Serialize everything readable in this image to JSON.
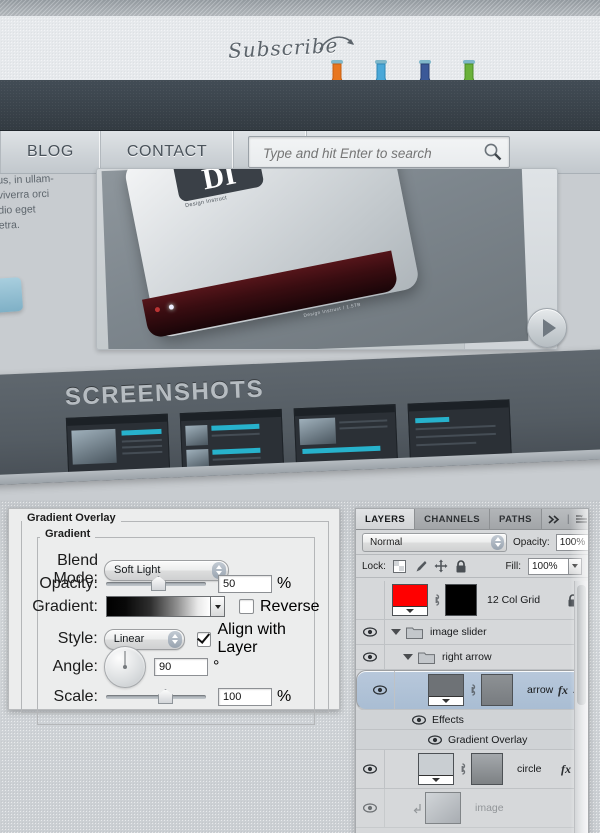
{
  "website": {
    "subscribe_label": "Subscribe",
    "social_icons": [
      {
        "name": "rss-flask-icon",
        "color": "#e8761e"
      },
      {
        "name": "twitter-flask-icon",
        "color": "#4aa8d8"
      },
      {
        "name": "facebook-flask-icon",
        "color": "#3b5998"
      },
      {
        "name": "email-flask-icon",
        "color": "#6ab13a"
      }
    ],
    "nav": [
      {
        "label": "BLOG"
      },
      {
        "label": "CONTACT"
      }
    ],
    "search": {
      "placeholder": "Type and hit Enter to search",
      "value": "",
      "icon": "search-icon"
    },
    "intro_text": "us, in ullam-\nviverra orci\ndio eget\netra.",
    "slider": {
      "product_logo": "DI",
      "product_caption": "Design Instruct",
      "product_footer": "Design Instruct   /   1.5TB",
      "next_icon": "play-triangle-icon"
    },
    "screenshots": {
      "title": "SCREENSHOTS",
      "thumbs": [
        "shot-1",
        "shot-2",
        "shot-3",
        "shot-4"
      ]
    }
  },
  "dialog": {
    "title": "Gradient Overlay",
    "group_title": "Gradient",
    "fields": {
      "blend_mode_label": "Blend Mode:",
      "blend_mode_value": "Soft Light",
      "opacity_label": "Opacity:",
      "opacity_value": "50",
      "opacity_unit": "%",
      "gradient_label": "Gradient:",
      "gradient_from": "#000000",
      "gradient_to": "#ffffff",
      "reverse_label": "Reverse",
      "reverse_checked": false,
      "style_label": "Style:",
      "style_value": "Linear",
      "align_label": "Align with Layer",
      "align_checked": true,
      "angle_label": "Angle:",
      "angle_value": "90",
      "angle_unit": "°",
      "scale_label": "Scale:",
      "scale_value": "100",
      "scale_unit": "%"
    }
  },
  "layers_panel": {
    "tabs": [
      {
        "label": "LAYERS",
        "active": true
      },
      {
        "label": "CHANNELS",
        "active": false
      },
      {
        "label": "PATHS",
        "active": false
      }
    ],
    "collapse_icon": "double-chevron-right-icon",
    "menu_icon": "panel-menu-icon",
    "blend_mode": "Normal",
    "opacity_label": "Opacity:",
    "opacity_value": "100%",
    "lock_label": "Lock:",
    "lock_icons": [
      "transparency-lock-icon",
      "brush-lock-icon",
      "move-lock-icon",
      "lock-all-icon"
    ],
    "fill_label": "Fill:",
    "fill_value": "100%",
    "rows": [
      {
        "name": "12 Col Grid",
        "type": "layer",
        "visible": false,
        "selected": false,
        "locked": true,
        "has_fx": false,
        "indent": 0,
        "thumb_color": "#ff0000",
        "mask_color": "#000000"
      },
      {
        "name": "image slider",
        "type": "group",
        "visible": true,
        "selected": false,
        "expanded": true,
        "indent": 0
      },
      {
        "name": "right arrow",
        "type": "group",
        "visible": true,
        "selected": false,
        "expanded": true,
        "indent": 1
      },
      {
        "name": "arrow",
        "type": "layer",
        "visible": true,
        "selected": true,
        "has_fx": true,
        "indent": 2,
        "thumb_color": "#6e7276",
        "mask_color": "#868a8e"
      },
      {
        "name": "Effects",
        "type": "effects",
        "visible": true,
        "indent": 3
      },
      {
        "name": "Gradient Overlay",
        "type": "effect",
        "visible": true,
        "indent": 4
      },
      {
        "name": "circle",
        "type": "layer",
        "visible": true,
        "selected": false,
        "has_fx": true,
        "indent": 2,
        "thumb_color": "#c9ced2",
        "mask_color": "#8d9194"
      },
      {
        "name": "image",
        "type": "layer",
        "visible": true,
        "selected": false,
        "clipped": true,
        "indent": 2,
        "thumb_color": "#b9bec3",
        "mask_color": ""
      }
    ]
  }
}
